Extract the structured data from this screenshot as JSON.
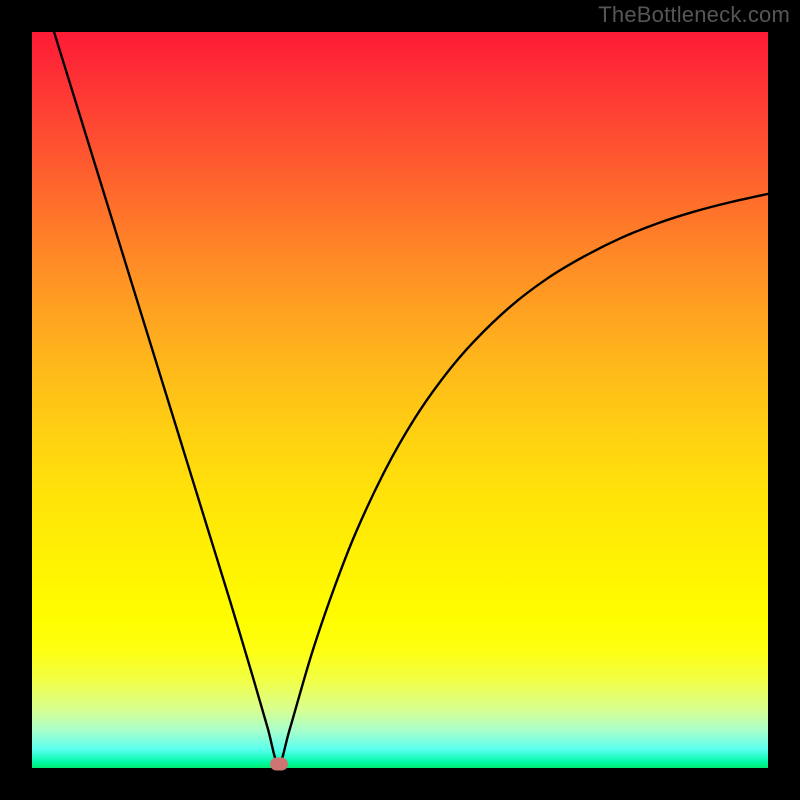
{
  "attribution": "TheBottleneck.com",
  "chart_data": {
    "type": "line",
    "title": "",
    "xlabel": "",
    "ylabel": "",
    "xlim": [
      0,
      100
    ],
    "ylim": [
      0,
      100
    ],
    "grid": false,
    "legend": false,
    "background_gradient": {
      "top_color": "#fe1b37",
      "bottom_color": "#00ea72",
      "description": "vertical rainbow gradient red-orange-yellow-green"
    },
    "series": [
      {
        "name": "bottleneck-curve",
        "color": "#000000",
        "x": [
          3,
          6,
          9,
          12,
          15,
          18,
          21,
          24,
          27,
          30,
          32,
          33.5,
          35,
          38,
          41,
          44,
          48,
          52,
          56,
          60,
          65,
          70,
          75,
          80,
          85,
          90,
          95,
          100
        ],
        "y": [
          100,
          90.3,
          80.6,
          70.9,
          61.2,
          51.5,
          41.8,
          32.1,
          22.4,
          12.4,
          5.5,
          0.5,
          5.2,
          15.5,
          24.3,
          32.0,
          40.5,
          47.5,
          53.2,
          57.9,
          62.7,
          66.5,
          69.5,
          72.0,
          74.0,
          75.6,
          76.9,
          78.0
        ]
      }
    ],
    "marker": {
      "x": 33.5,
      "y": 0.5,
      "color": "#ce7573",
      "shape": "rounded-rect"
    }
  }
}
